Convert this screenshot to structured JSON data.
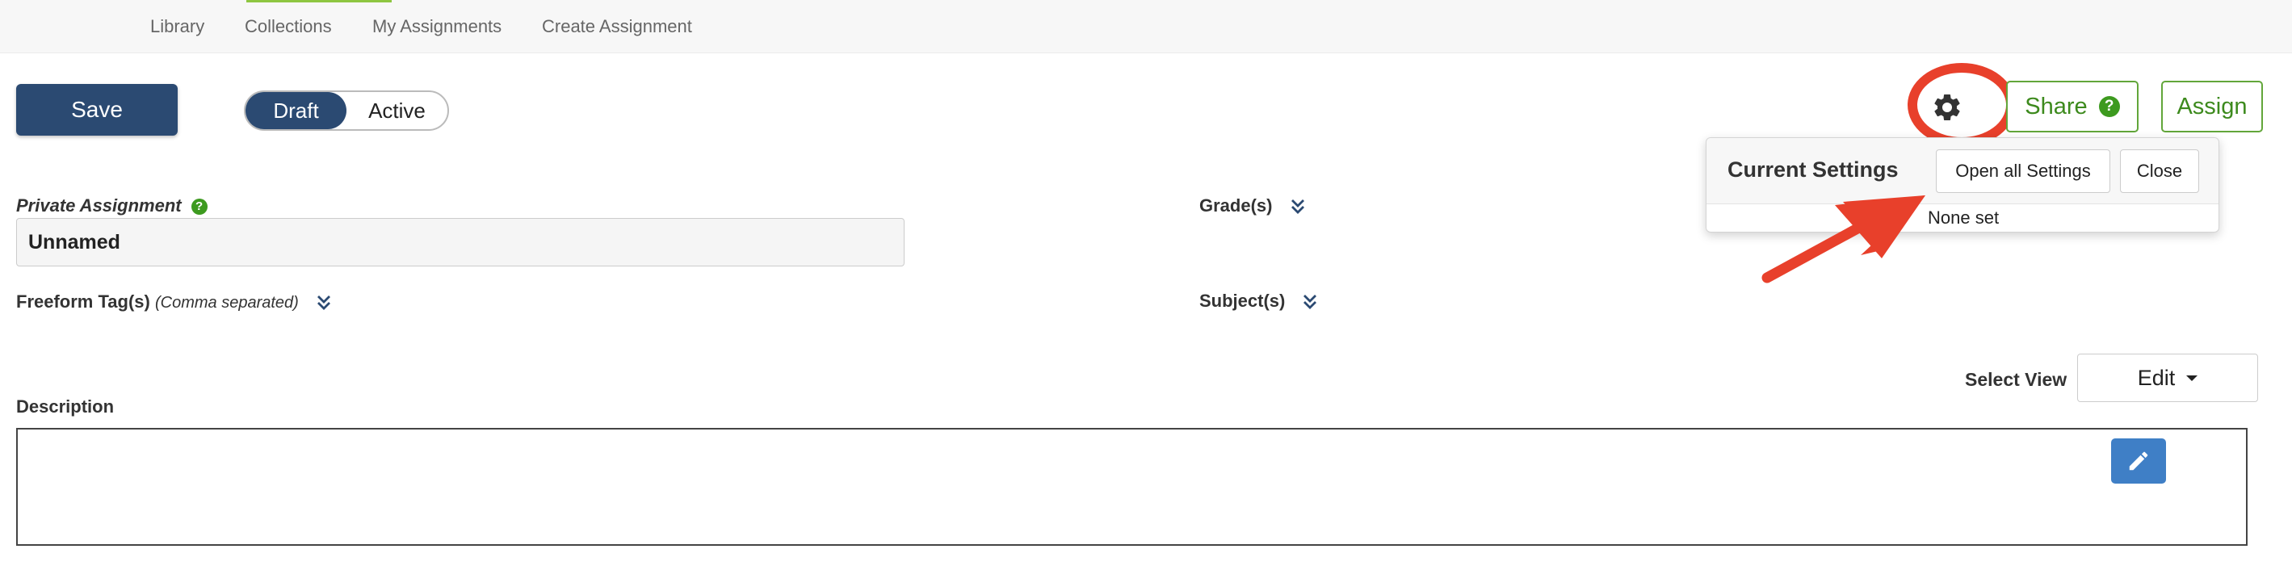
{
  "topnav": {
    "items": [
      {
        "label": "Library"
      },
      {
        "label": "Collections"
      },
      {
        "label": "My Assignments"
      },
      {
        "label": "Create Assignment"
      }
    ]
  },
  "toolbar": {
    "save_label": "Save",
    "status_toggle": {
      "options": [
        "Draft",
        "Active"
      ],
      "selected": "Draft"
    },
    "settings_icon": "gear-icon",
    "share_label": "Share",
    "share_help_icon": "question-circle-icon",
    "assign_label": "Assign"
  },
  "settings_popover": {
    "title": "Current Settings",
    "open_all_label": "Open all Settings",
    "close_label": "Close",
    "body": "None set"
  },
  "form": {
    "private_assignment_label": "Private Assignment",
    "name_value": "Unnamed",
    "freeform_tags_label": "Freeform Tag(s)",
    "freeform_tags_hint": "(Comma separated)",
    "grades_label": "Grade(s)",
    "subjects_label": "Subject(s)",
    "select_view_label": "Select View",
    "select_view_value": "Edit",
    "description_label": "Description"
  },
  "colors": {
    "primary": "#2b4a72",
    "green": "#3d8a1d",
    "annotation_red": "#e8402b",
    "edit_blue": "#3f7fc6"
  }
}
